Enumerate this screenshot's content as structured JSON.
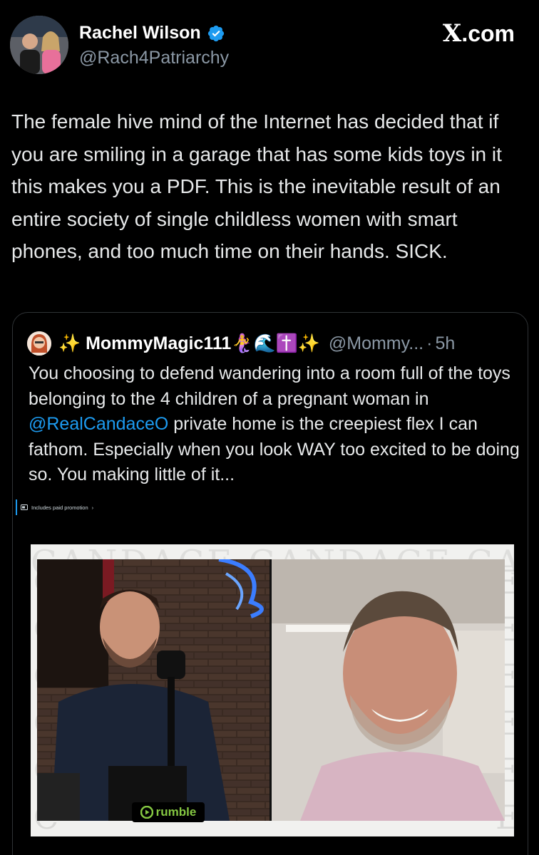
{
  "author": {
    "display_name": "Rachel Wilson",
    "handle": "@Rach4Patriarchy",
    "verified": true,
    "avatar_icon": "profile-photo-icon"
  },
  "brand": {
    "label": ".com",
    "glyph": "X"
  },
  "tweet": {
    "text": "The female hive mind of the Internet has decided that if you are smiling in a garage that has some kids toys in it this makes you a PDF. This is the inevitable result of an entire society of single childless women with smart phones, and too much time on their hands. SICK."
  },
  "quote": {
    "display_name": "✨ MommyMagic111🧜‍♀️🌊✝️✨",
    "handle": "@Mommy...",
    "separator": "·",
    "time": "5h",
    "text_before": "You choosing to defend wandering into a room full of the toys belonging to the 4 children of a pregnant woman in ",
    "mention": "@RealCandaceO",
    "text_after": " private home is the creepiest flex I can fathom. Especially when you look WAY too excited to be doing so. You making little of it...",
    "media": {
      "promo_label": "Includes paid promotion",
      "promo_chevron": "›",
      "watermark_text": "CANDACE CANDACE CANDACE",
      "watermark_letter": "C",
      "watermark_letter_right": "E",
      "rumble_label": "rumble"
    }
  },
  "colors": {
    "background": "#000000",
    "text": "#e7e9ea",
    "secondary": "#8b98a5",
    "link": "#1d9bf0",
    "verified": "#1d9bf0",
    "rumble": "#85c742"
  }
}
